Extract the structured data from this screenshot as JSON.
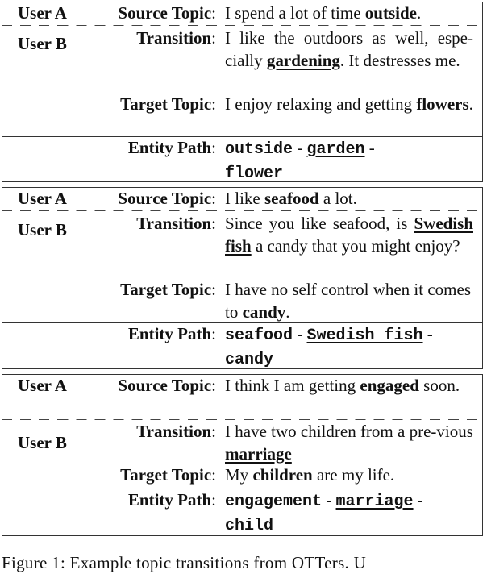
{
  "labels": {
    "user_a": "User A",
    "user_b": "User B",
    "source_topic": "Source Topic",
    "transition": "Transition",
    "target_topic": "Target Topic",
    "entity_path": "Entity Path",
    "colon": ":"
  },
  "examples": [
    {
      "source": {
        "pre": "I spend a lot of time ",
        "bold": "outside",
        "post": "."
      },
      "transition": {
        "pre": "I like the outdoors as well, espe-cially ",
        "bold_underlined": "gardening",
        "post": ". It destresses me."
      },
      "target": {
        "pre": "I enjoy relaxing and getting ",
        "bold": "flowers",
        "post": "."
      },
      "entity_path": {
        "e1": "outside",
        "e2": "garden",
        "e3": "flower",
        "sep": " - "
      }
    },
    {
      "source": {
        "pre": "I like ",
        "bold": "seafood",
        "post": " a lot."
      },
      "transition": {
        "pre": "Since you like seafood, is ",
        "bold_underlined": "Swedish fish",
        "post": " a candy that you might enjoy?"
      },
      "target": {
        "pre": "I have no self control when it comes to ",
        "bold": "candy",
        "post": "."
      },
      "entity_path": {
        "e1": "seafood",
        "e2": "Swedish fish",
        "e3": "candy",
        "sep": " - "
      }
    },
    {
      "source": {
        "pre": "I think I am getting ",
        "bold": "engaged",
        "post": " soon."
      },
      "transition": {
        "pre": "I have two children from a pre-vious ",
        "bold_underlined": "marriage",
        "post": ""
      },
      "target": {
        "pre": "My ",
        "bold": "children",
        "post": " are my life."
      },
      "entity_path": {
        "e1": "engagement",
        "e2": "marriage",
        "e3": "child",
        "sep": " - "
      }
    }
  ],
  "caption": "Figure 1: Example topic transitions from OTTers. U"
}
